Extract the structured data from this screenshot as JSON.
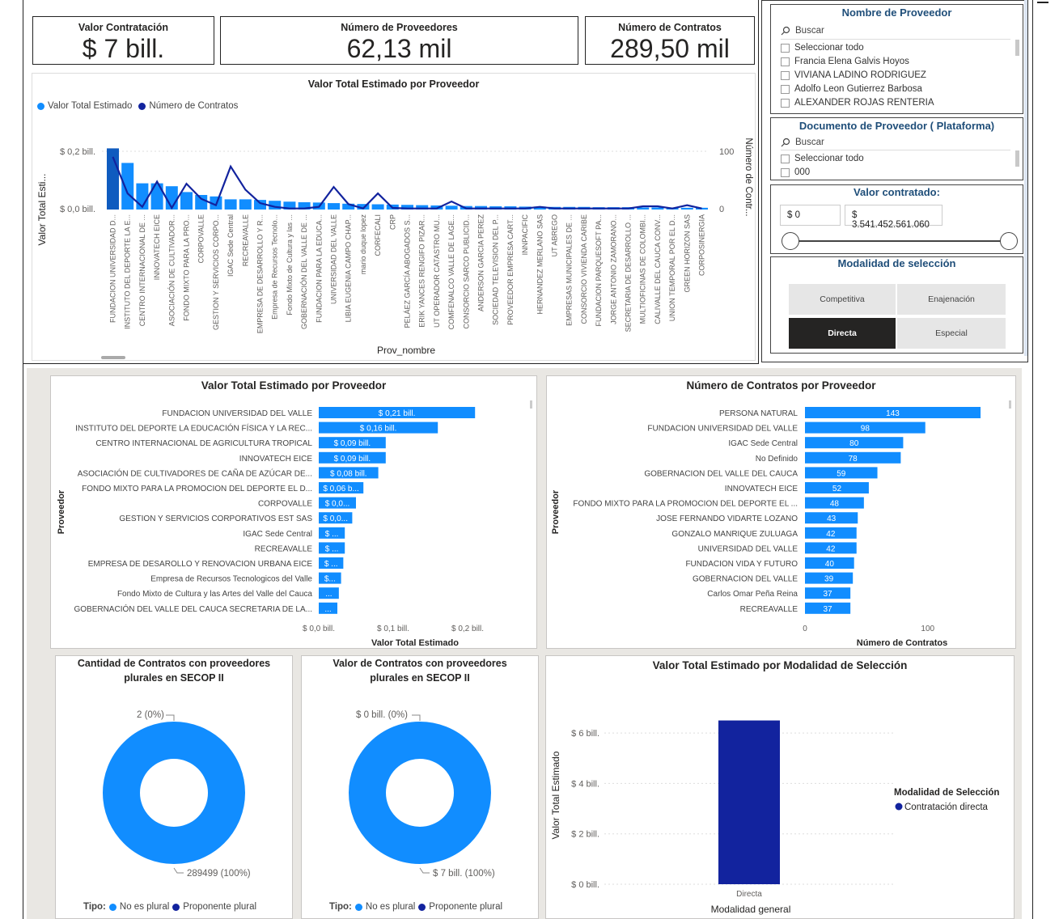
{
  "kpis": {
    "valor_contratacion": {
      "title": "Valor Contratación",
      "value": "$ 7 bill."
    },
    "numero_proveedores": {
      "title": "Número de Proveedores",
      "value": "62,13 mil"
    },
    "numero_contratos": {
      "title": "Número de Contratos",
      "value": "289,50 mil"
    }
  },
  "combo_chart": {
    "title": "Valor Total Estimado por Proveedor",
    "legend": [
      {
        "label": "Valor Total Estimado",
        "color": "#118dff"
      },
      {
        "label": "Número de Contratos",
        "color": "#12239e"
      }
    ],
    "y_left_label": "Valor Total Esti...",
    "y_right_label": "Número de Contr...",
    "x_label": "Prov_nombre",
    "y_left_ticks": [
      "$ 0,2 bill.",
      "$ 0,0 bill."
    ],
    "y_right_ticks": [
      "100",
      "0"
    ]
  },
  "chart_data": [
    {
      "type": "bar",
      "title": "Valor Total Estimado por Proveedor",
      "xlabel": "Prov_nombre",
      "ylabel": "Valor Total Esti...",
      "y2label": "Número de Contr...",
      "ylim": [
        0,
        0.26
      ],
      "y2lim": [
        0,
        130
      ],
      "categories": [
        "FUNDACION UNIVERSIDAD D...",
        "INSTITUTO DEL DEPORTE LA E...",
        "CENTRO INTERNACIONAL DE ...",
        "INNOVATECH EICE",
        "ASOCIACIÓN DE CULTIVADOR...",
        "FONDO MIXTO PARA LA PRO...",
        "CORPOVALLE",
        "GESTION Y SERVICIOS CORPO...",
        "IGAC Sede Central",
        "RECREAVALLE",
        "EMPRESA DE DESARROLLO Y R...",
        "Empresa de Recursos Tecnolo...",
        "Fondo Mixto de Cultura y las ...",
        "GOBERNACIÓN DEL VALLE DE ...",
        "FUNDACION PARA LA EDUCA...",
        "UNIVERSIDAD DEL VALLE",
        "LIBIA EUGENIA CAMPO CHAP...",
        "mario duque lopez",
        "CORFECALI",
        "CRP",
        "PELÁEZ GARCÍA ABOGADOS S...",
        "ERIK YANCES RENGIFO PIZAR...",
        "UT OPERADOR CATASTRO MU...",
        "COMFENALCO VALLE DE LAGE...",
        "CONSORCIO SARCO PUBLICID...",
        "ANDERSON GARCIA PEREZ",
        "SOCIEDAD TELEVISION DEL P...",
        "PROVEEDOR EMPRESA CART...",
        "INNPACIFIC",
        "HERNANDEZ MERLANO SAS",
        "UT ABREGO",
        "EMPRESAS MUNICIPALES DE ...",
        "CONSORCIO VIVIENDA CARIBE",
        "FUNDACION PARQUESOFT PA...",
        "JORGE ANTONIO ZAMORANO...",
        "SECRETARIA DE DESARROLLO ...",
        "MULTIOFICINAS DE COLOMBI...",
        "CALIVALLE DEL CAUCA CONV...",
        "UNION TEMPORAL POR EL D...",
        "GREEN HORIZON SAS",
        "CORPOSINERGIA"
      ],
      "series": [
        {
          "name": "Valor Total Estimado",
          "values": [
            0.21,
            0.16,
            0.09,
            0.09,
            0.08,
            0.06,
            0.05,
            0.045,
            0.035,
            0.035,
            0.033,
            0.03,
            0.027,
            0.025,
            0.024,
            0.022,
            0.02,
            0.019,
            0.018,
            0.017,
            0.016,
            0.015,
            0.014,
            0.013,
            0.012,
            0.012,
            0.011,
            0.011,
            0.01,
            0.01,
            0.009,
            0.009,
            0.009,
            0.008,
            0.008,
            0.008,
            0.007,
            0.007,
            0.007,
            0.006,
            0.006
          ]
        },
        {
          "name": "Número de Contratos",
          "values": [
            98,
            30,
            5,
            52,
            3,
            48,
            20,
            8,
            80,
            37,
            12,
            5,
            2,
            2,
            5,
            42,
            10,
            2,
            30,
            3,
            2,
            2,
            2,
            15,
            2,
            2,
            2,
            2,
            2,
            5,
            2,
            2,
            2,
            2,
            2,
            2,
            6,
            6,
            2,
            8,
            2
          ]
        }
      ]
    },
    {
      "type": "bar",
      "orientation": "horizontal",
      "title": "Valor Total Estimado por Proveedor",
      "xlabel": "Valor Total Estimado",
      "ylabel": "Proveedor",
      "xlim": [
        0,
        0.25
      ],
      "x_ticks": [
        "$ 0,0 bill.",
        "$ 0,1 bill.",
        "$ 0,2 bill."
      ],
      "categories": [
        "FUNDACION UNIVERSIDAD DEL VALLE",
        "INSTITUTO DEL DEPORTE LA EDUCACIÓN FÍSICA Y LA REC...",
        "CENTRO INTERNACIONAL DE AGRICULTURA TROPICAL",
        "INNOVATECH EICE",
        "ASOCIACIÓN DE CULTIVADORES DE CAÑA DE AZÚCAR DE...",
        "FONDO MIXTO PARA LA PROMOCION DEL DEPORTE EL D...",
        "CORPOVALLE",
        "GESTION Y SERVICIOS CORPORATIVOS EST SAS",
        "IGAC Sede Central",
        "RECREAVALLE",
        "EMPRESA DE DESAROLLO Y RENOVACION URBANA EICE",
        "Empresa de Recursos Tecnologicos del Valle",
        "Fondo Mixto de Cultura y las Artes del Valle del Cauca",
        "GOBERNACIÓN DEL VALLE DEL CAUCA SECRETARIA DE LA..."
      ],
      "values": [
        0.21,
        0.16,
        0.09,
        0.09,
        0.08,
        0.06,
        0.05,
        0.045,
        0.035,
        0.035,
        0.033,
        0.03,
        0.027,
        0.025
      ],
      "data_labels": [
        "$ 0,21 bill.",
        "$ 0,16 bill.",
        "$ 0,09 bill.",
        "$ 0,09 bill.",
        "$ 0,08 bill.",
        "$ 0,06 b...",
        "$ 0,0...",
        "$ 0,0...",
        "$ ...",
        "$ ...",
        "$ ...",
        "$...",
        "...",
        "..."
      ]
    },
    {
      "type": "bar",
      "orientation": "horizontal",
      "title": "Número de Contratos por Proveedor",
      "xlabel": "Número de Contratos",
      "ylabel": "Proveedor",
      "xlim": [
        0,
        170
      ],
      "x_ticks": [
        "0",
        "100"
      ],
      "categories": [
        "PERSONA NATURAL",
        "FUNDACION UNIVERSIDAD DEL VALLE",
        "IGAC Sede Central",
        "No Definido",
        "GOBERNACION DEL VALLE DEL CAUCA",
        "INNOVATECH EICE",
        "FONDO MIXTO PARA LA PROMOCION DEL DEPORTE EL ...",
        "JOSE FERNANDO VIDARTE LOZANO",
        "GONZALO MANRIQUE ZULUAGA",
        "UNIVERSIDAD DEL VALLE",
        "FUNDACION VIDA Y FUTURO",
        "GOBERNACION DEL VALLE",
        "Carlos Omar Peña Reina",
        "RECREAVALLE"
      ],
      "values": [
        143,
        98,
        80,
        78,
        59,
        52,
        48,
        43,
        42,
        42,
        40,
        39,
        37,
        37
      ]
    },
    {
      "type": "pie",
      "title": "Cantidad de Contratos con proveedores plurales en SECOP II",
      "legend_title": "Tipo:",
      "categories": [
        "No es plural",
        "Proponente plural"
      ],
      "values": [
        289499,
        2
      ],
      "data_labels": [
        "289499 (100%)",
        "2 (0%)"
      ]
    },
    {
      "type": "pie",
      "title": "Valor de Contratos con proveedores plurales en SECOP II",
      "legend_title": "Tipo:",
      "categories": [
        "No es plural",
        "Proponente plural"
      ],
      "values": [
        7,
        0
      ],
      "data_labels": [
        "$ 7 bill. (100%)",
        "$ 0 bill. (0%)"
      ]
    },
    {
      "type": "bar",
      "title": "Valor Total Estimado por Modalidad de Selección",
      "xlabel": "Modalidad general",
      "ylabel": "Valor Total Estimado",
      "ylim": [
        0,
        7
      ],
      "y_ticks": [
        "$ 0 bill.",
        "$ 2 bill.",
        "$ 4 bill.",
        "$ 6 bill."
      ],
      "categories": [
        "Directa"
      ],
      "series": [
        {
          "name": "Contratación directa",
          "values": [
            6.5
          ]
        }
      ],
      "legend_title": "Modalidad de Selección"
    }
  ],
  "colors": {
    "light_blue": "#118dff",
    "dark_blue": "#12239e",
    "dark_bar": "#0f5bbf"
  },
  "slicer_proveedor": {
    "title": "Nombre de Proveedor",
    "search": "Buscar",
    "items": [
      "Seleccionar todo",
      "Francia Elena Galvis Hoyos",
      "VIVIANA LADINO RODRIGUEZ",
      "Adolfo Leon Gutierrez Barbosa",
      "ALEXANDER ROJAS RENTERIA"
    ]
  },
  "slicer_documento": {
    "title": "Documento de Proveedor ( Plataforma)",
    "search": "Buscar",
    "items": [
      "Seleccionar todo",
      "000"
    ]
  },
  "slicer_valor": {
    "title": "Valor contratado:",
    "min": "$ 0",
    "max": "$ 3.541.452.561.060"
  },
  "slicer_modalidad": {
    "title": "Modalidad de selección",
    "buttons": [
      "Competitiva",
      "Enajenación",
      "Directa",
      "Especial"
    ],
    "selected": "Directa"
  },
  "hbar1": {
    "title": "Valor Total Estimado por Proveedor",
    "ylabel": "Proveedor",
    "xlabel": "Valor Total Estimado"
  },
  "hbar2": {
    "title": "Número de Contratos por Proveedor",
    "ylabel": "Proveedor",
    "xlabel": "Número de Contratos"
  },
  "donut1": {
    "title_line1": "Cantidad de Contratos con proveedores",
    "title_line2": "plurales en SECOP II",
    "top_label": "2 (0%)",
    "bottom_label": "289499 (100%)",
    "legend_title": "Tipo:",
    "legend": [
      "No es plural",
      "Proponente plural"
    ]
  },
  "donut2": {
    "title_line1": "Valor de Contratos con proveedores",
    "title_line2": "plurales en SECOP II",
    "top_label": "$ 0 bill. (0%)",
    "bottom_label": "$ 7 bill. (100%)",
    "legend_title": "Tipo:",
    "legend": [
      "No es plural",
      "Proponente plural"
    ]
  },
  "modalidad_chart": {
    "title": "Valor Total Estimado por Modalidad de Selección",
    "ylabel": "Valor Total Estimado",
    "xlabel": "Modalidad general",
    "category": "Directa",
    "legend_title": "Modalidad de Selección",
    "legend_item": "Contratación directa"
  }
}
